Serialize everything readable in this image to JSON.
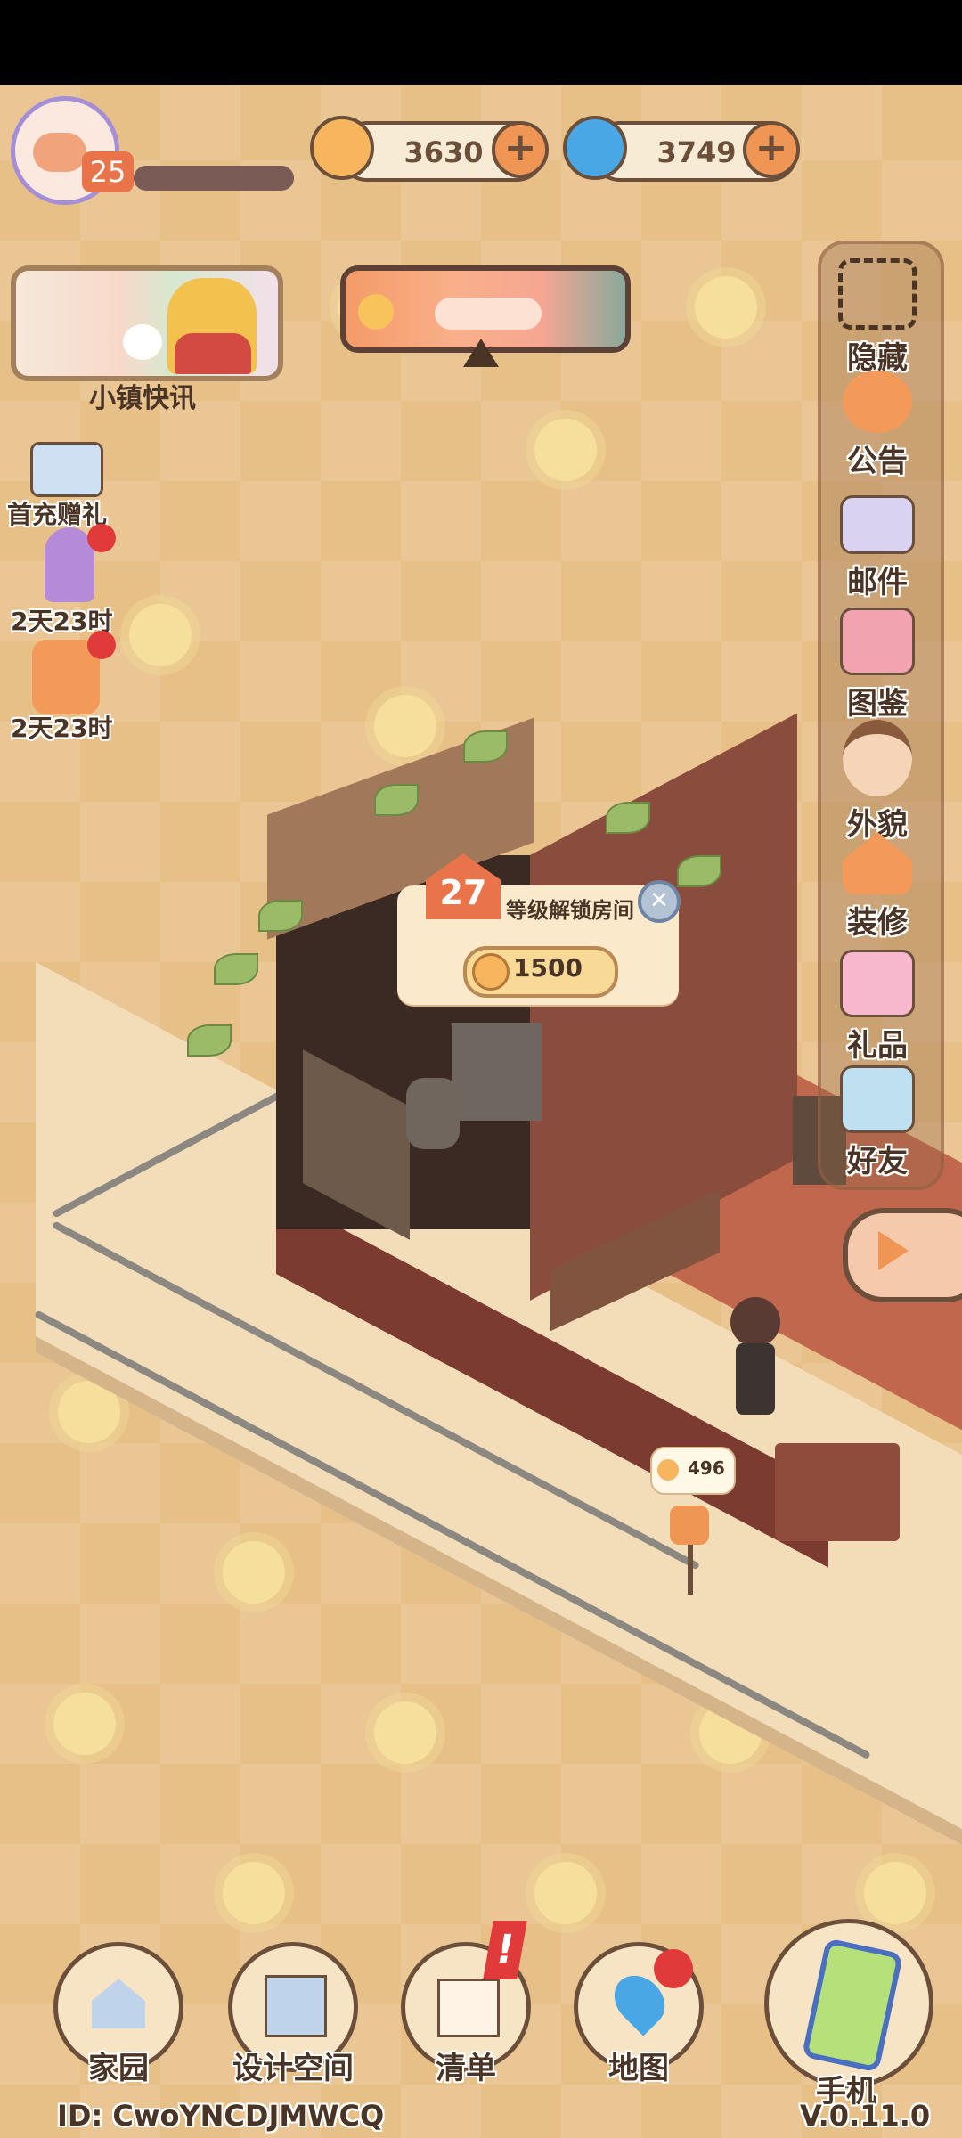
{
  "player": {
    "level": "25"
  },
  "currencies": [
    {
      "name": "coin",
      "icon": "coin-icon",
      "value": "3630",
      "color": "#f7b55d"
    },
    {
      "name": "gem",
      "icon": "swirl-gem-icon",
      "value": "3749",
      "color": "#4aa7e6"
    }
  ],
  "news": {
    "label": "小镇快讯"
  },
  "left_events": [
    {
      "label": "首充赠礼",
      "icon": "gift-box-icon"
    },
    {
      "label": "2天23时",
      "icon": "mystery-question-icon"
    },
    {
      "label": "2天23时",
      "icon": "cat-jar-icon"
    }
  ],
  "right_menu": [
    {
      "label": "隐藏",
      "icon": "hide-frame-icon"
    },
    {
      "label": "公告",
      "icon": "megaphone-icon"
    },
    {
      "label": "邮件",
      "icon": "envelope-icon"
    },
    {
      "label": "图鉴",
      "icon": "album-book-icon"
    },
    {
      "label": "外貌",
      "icon": "avatar-face-icon"
    },
    {
      "label": "装修",
      "icon": "house-wrench-icon"
    },
    {
      "label": "礼品",
      "icon": "gift-icon"
    },
    {
      "label": "好友",
      "icon": "friend-card-icon"
    }
  ],
  "unlock": {
    "level": "27",
    "text": "等级解锁房间",
    "cost": "1500"
  },
  "mailbox": {
    "count": "496"
  },
  "bottom_nav": [
    {
      "label": "家园",
      "icon": "home-icon"
    },
    {
      "label": "设计空间",
      "icon": "design-ruler-icon"
    },
    {
      "label": "清单",
      "icon": "checklist-icon"
    },
    {
      "label": "地图",
      "icon": "map-pin-icon"
    },
    {
      "label": "手机",
      "icon": "phone-icon"
    }
  ],
  "footer": {
    "id_text": "ID: CwoYNCDJMWCQ",
    "version": "V.0.11.0"
  }
}
